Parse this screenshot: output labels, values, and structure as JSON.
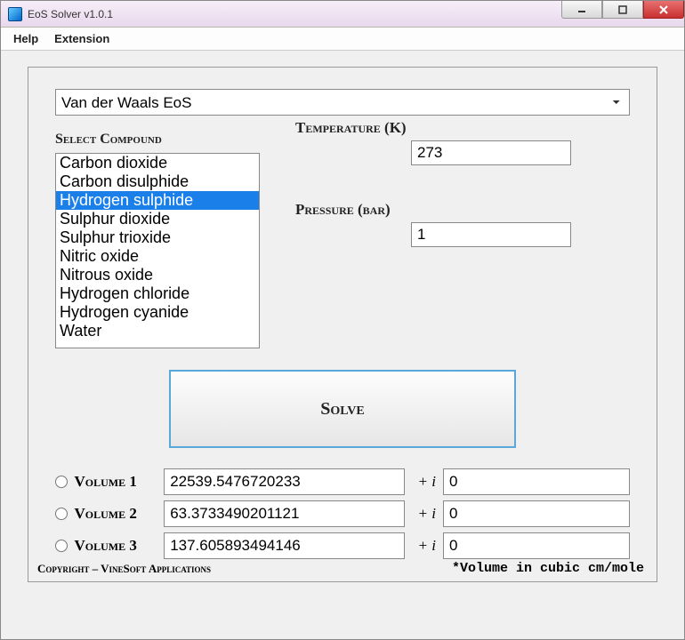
{
  "window": {
    "title": "EoS Solver v1.0.1"
  },
  "menu": {
    "help": "Help",
    "extension": "Extension"
  },
  "eos": {
    "selected": "Van der Waals EoS"
  },
  "compound": {
    "label": "Select Compound",
    "items": [
      "Carbon dioxide",
      "Carbon disulphide",
      "Hydrogen sulphide",
      "Sulphur dioxide",
      "Sulphur trioxide",
      "Nitric oxide",
      "Nitrous oxide",
      "Hydrogen chloride",
      "Hydrogen cyanide",
      "Water"
    ],
    "selected_index": 2
  },
  "inputs": {
    "temperature_label": "Temperature (K)",
    "temperature_value": "273",
    "pressure_label": "Pressure (bar)",
    "pressure_value": "1"
  },
  "solve_label": "Solve",
  "results": {
    "plus_i": "+ i",
    "rows": [
      {
        "label": "Volume 1",
        "real": "22539.5476720233",
        "imag": "0"
      },
      {
        "label": "Volume 2",
        "real": "63.3733490201121",
        "imag": "0"
      },
      {
        "label": "Volume 3",
        "real": "137.605893494146",
        "imag": "0"
      }
    ]
  },
  "footer": {
    "copyright": "Copyright – VineSoft Applications",
    "unit_note": "*Volume in cubic cm/mole"
  }
}
